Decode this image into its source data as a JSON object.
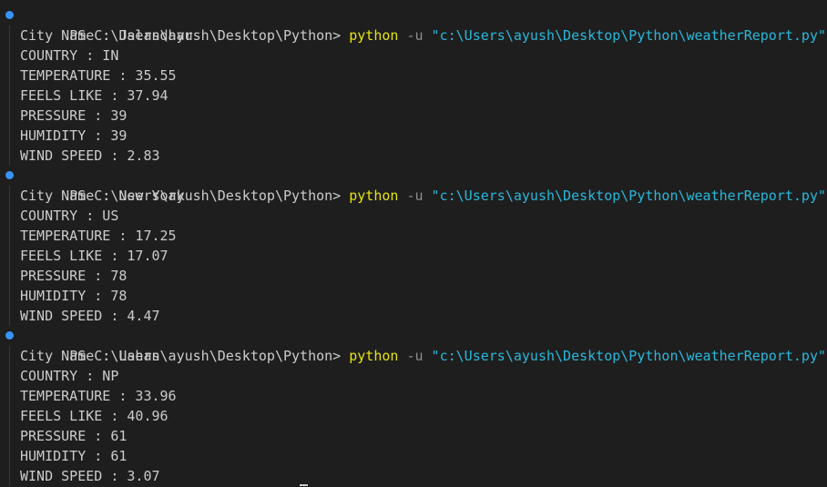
{
  "terminal": {
    "colors": {
      "background": "#1e1e1e",
      "text": "#cccccc",
      "command": "#e5e510",
      "flag": "#8f8f8f",
      "path": "#29b8db",
      "decoration": "#3794ff"
    },
    "runs": [
      {
        "prompt": "PS C:\\Users\\ayush\\Desktop\\Python> ",
        "command": "python",
        "flag": " -u ",
        "path": "\"c:\\Users\\ayush\\Desktop\\Python\\weatherReport.py\"",
        "output": [
          "City Name : Jalandhar",
          "COUNTRY : IN",
          "TEMPERATURE : 35.55",
          "FEELS LIKE : 37.94",
          "PRESSURE : 39",
          "HUMIDITY : 39",
          "WIND SPEED : 2.83"
        ]
      },
      {
        "prompt": "PS C:\\Users\\ayush\\Desktop\\Python> ",
        "command": "python",
        "flag": " -u ",
        "path": "\"c:\\Users\\ayush\\Desktop\\Python\\weatherReport.py\"",
        "output": [
          "City Name : New York",
          "COUNTRY : US",
          "TEMPERATURE : 17.25",
          "FEELS LIKE : 17.07",
          "PRESSURE : 78",
          "HUMIDITY : 78",
          "WIND SPEED : 4.47"
        ]
      },
      {
        "prompt": "PS C:\\Users\\ayush\\Desktop\\Python> ",
        "command": "python",
        "flag": " -u ",
        "path": "\"c:\\Users\\ayush\\Desktop\\Python\\weatherReport.py\"",
        "output": [
          "City Name : Lahan",
          "COUNTRY : NP",
          "TEMPERATURE : 33.96",
          "FEELS LIKE : 40.96",
          "PRESSURE : 61",
          "HUMIDITY : 61",
          "WIND SPEED : 3.07"
        ]
      }
    ]
  }
}
